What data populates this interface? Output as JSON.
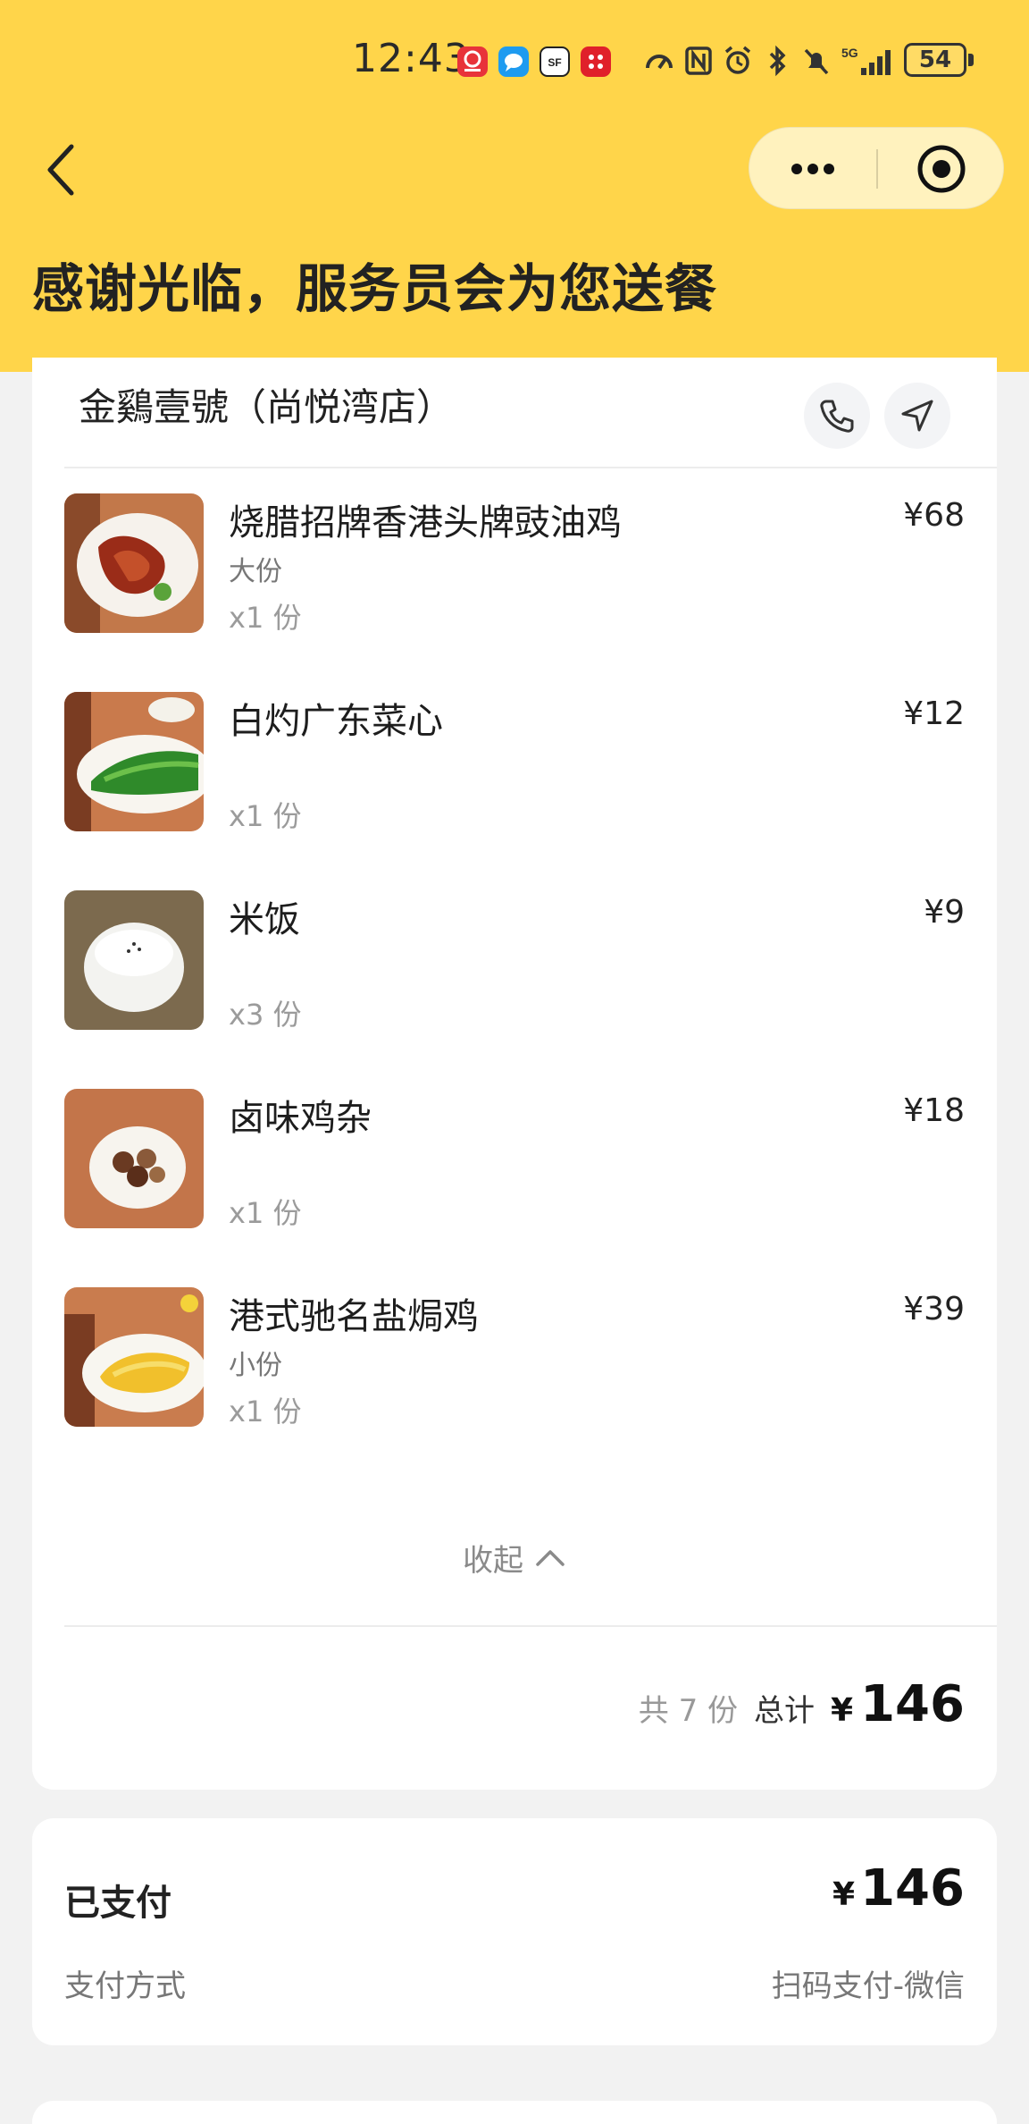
{
  "status_bar": {
    "time": "12:43",
    "app_icons": [
      {
        "icon": "bank-app-icon",
        "color": "#e8333a"
      },
      {
        "icon": "message-app-icon",
        "color": "#1e9bf0"
      },
      {
        "icon": "sf-express-app-icon",
        "color": "#222222"
      },
      {
        "icon": "red-app-icon",
        "color": "#e0202a"
      }
    ],
    "network": "5G",
    "battery": "54"
  },
  "header": {
    "background": "#ffd54a",
    "title": "感谢光临，服务员会为您送餐"
  },
  "order": {
    "shop_name": "金鷄壹號（尚悦湾店）",
    "items": [
      {
        "name": "烧腊招牌香港头牌豉油鸡",
        "spec": "大份",
        "qty": "x1 份",
        "price": "¥68"
      },
      {
        "name": "白灼广东菜心",
        "spec": "",
        "qty": "x1 份",
        "price": "¥12"
      },
      {
        "name": "米饭",
        "spec": "",
        "qty": "x3 份",
        "price": "¥9"
      },
      {
        "name": "卤味鸡杂",
        "spec": "",
        "qty": "x1 份",
        "price": "¥18"
      },
      {
        "name": "港式驰名盐焗鸡",
        "spec": "小份",
        "qty": "x1 份",
        "price": "¥39"
      }
    ],
    "collapse_label": "收起",
    "summary": {
      "count": "共 7 份",
      "total_label": "总计",
      "currency": "¥",
      "total": "146"
    }
  },
  "payment": {
    "status": "已支付",
    "currency": "¥",
    "amount": "146",
    "method_label": "支付方式",
    "method_value": "扫码支付-微信"
  }
}
